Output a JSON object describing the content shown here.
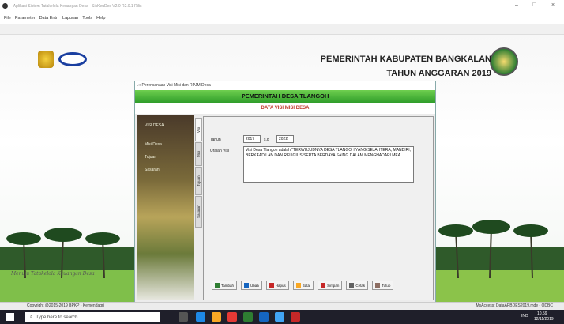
{
  "window": {
    "title": "- Aplikasi Sistem Tatakelola Keuangan Desa - SisKeuDes V2.0 R2.0.1 Rilis",
    "controls": {
      "minimize": "–",
      "maximize": "□",
      "close": "×"
    }
  },
  "menu": [
    "File",
    "Parameter",
    "Data Entri",
    "Laporan",
    "Tools",
    "Help"
  ],
  "header": {
    "line1": "PEMERINTAH KABUPATEN BANGKALAN",
    "line2": "TAHUN ANGGARAN 2019"
  },
  "bg_slogan": "Menuju Tatakelola Keuangan Desa",
  "statusbar": {
    "left": "Copyright @2015-2019 BPKP - Kemendagri",
    "right": "MsAccess: DataAPBDES2019.mde - ODBC"
  },
  "dialog": {
    "title": ".:: Perencanaan Visi Misi dan RPJM Desa",
    "heading": "PEMERINTAH DESA TLANGOH",
    "subheading": "DATA VISI MISI DESA",
    "left_nav": [
      "VISI DESA",
      "Misi Desa",
      "Tujuan",
      "Sasaran"
    ],
    "tabs": [
      "Visi",
      "Misi",
      "Tujuan",
      "Sasaran"
    ],
    "form": {
      "tahun_label": "Tahun",
      "tahun_from": "2017",
      "sd_label": "s.d",
      "tahun_to": "2022",
      "uraian_label": "Uraian Visi",
      "uraian_value": "Visi Desa Tlangoh adalah \"TERWUJUDNYA DESA TLANGOH YANG SEJAHTERA, MANDIRI, BERKEADILAN DAN RELIGIUS SERTA BERDAYA SAING DALAM MENGHADAPI MEA"
    },
    "buttons": [
      "Tambah",
      "Ubah",
      "Hapus",
      "Batal",
      "Simpan",
      "Cetak",
      "Tutup"
    ]
  },
  "taskbar": {
    "search_placeholder": "Type here to search",
    "lang": "IND",
    "time": "10.59",
    "date": "12/11/2019"
  },
  "colors": {
    "dialog_header": "#2f9d2a",
    "subheading": "#c0392b",
    "taskbar": "#1f1f2a"
  }
}
